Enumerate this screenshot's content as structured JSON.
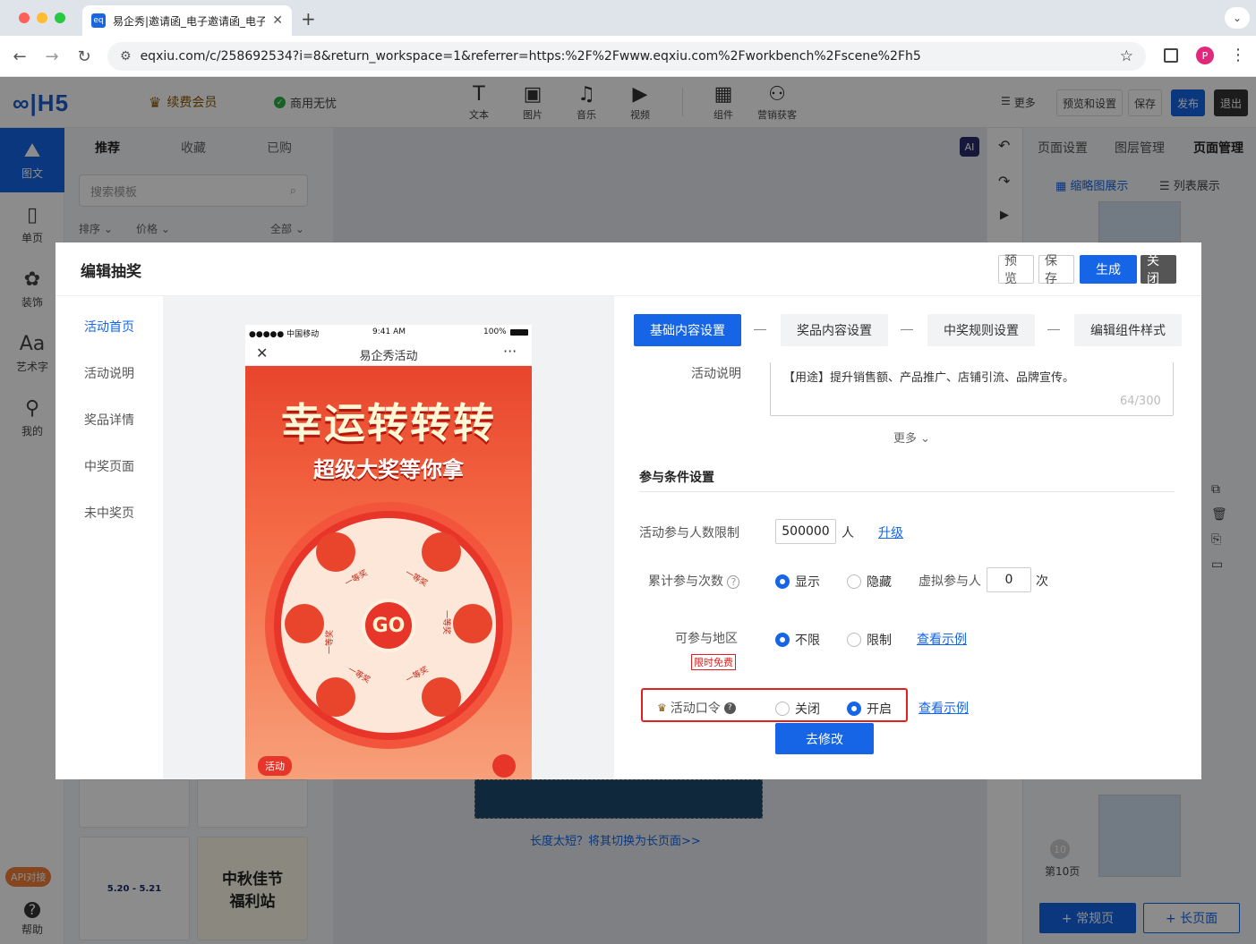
{
  "browser": {
    "tab_title": "易企秀|邀请函_电子邀请函_电子",
    "tab_favicon": "eq",
    "url": "eqxiu.com/c/258692534?i=8&return_workspace=1&referrer=https:%2F%2Fwww.eqxiu.com%2Fworkbench%2Fscene%2Fh5",
    "profile_initial": "P"
  },
  "app_header": {
    "logo": "∞|H5",
    "vip_label": "续费会员",
    "commercial_label": "商用无忧",
    "tools": [
      "文本",
      "图片",
      "音乐",
      "视频",
      "组件",
      "营销获客"
    ],
    "more": "更多",
    "preview_settings": "预览和设置",
    "save": "保存",
    "publish": "发布",
    "exit": "退出"
  },
  "rail": {
    "items": [
      "图文",
      "单页",
      "装饰",
      "艺术字",
      "我的"
    ],
    "api_label": "API对接",
    "help_label": "帮助"
  },
  "template_panel": {
    "tabs": [
      "推荐",
      "收藏",
      "已购"
    ],
    "search_placeholder": "搜索模板",
    "filters": [
      "排序",
      "价格",
      "全部"
    ],
    "thumb_text_1": "中秋佳节",
    "thumb_text_2": "福利站",
    "thumb_date": "5.20 - 5.21"
  },
  "canvas": {
    "hint": "长度太短？将其切换为长页面>>",
    "ai_label": "AI"
  },
  "right_panel": {
    "tabs": [
      "页面设置",
      "图层管理",
      "页面管理"
    ],
    "view_thumb": "缩略图展示",
    "view_list": "列表展示",
    "page_badge": "10",
    "page_label": "第10页",
    "add_normal": "+ 常规页",
    "add_long": "+ 长页面"
  },
  "modal": {
    "title": "编辑抽奖",
    "btn_preview": "预览",
    "btn_save": "保存",
    "btn_generate": "生成",
    "btn_close": "关闭",
    "side_items": [
      "活动首页",
      "活动说明",
      "奖品详情",
      "中奖页面",
      "未中奖页"
    ],
    "phone": {
      "carrier": "●●●●● 中国移动",
      "time": "9:41 AM",
      "battery": "100%",
      "page_title": "易企秀活动",
      "banner_title": "幸运转转转",
      "banner_sub": "超级大奖等你拿",
      "go": "GO",
      "prize_labels": [
        "一等奖",
        "一等奖",
        "一等奖",
        "一等奖",
        "一等奖",
        "一等奖"
      ],
      "bottom_badge": "活动"
    },
    "steps": [
      "基础内容设置",
      "奖品内容设置",
      "中奖规则设置",
      "编辑组件样式"
    ],
    "desc_label": "活动说明",
    "desc_text": "【用途】提升销售额、产品推广、店铺引流、品牌宣传。",
    "desc_count": "64/300",
    "more": "更多",
    "section_title": "参与条件设置",
    "limit_label": "活动参与人数限制",
    "limit_value": "500000",
    "limit_unit": "人",
    "upgrade": "升级",
    "count_label": "累计参与次数",
    "show": "显示",
    "hide": "隐藏",
    "virtual_label": "虚拟参与人",
    "virtual_value": "0",
    "virtual_unit": "次",
    "region_label": "可参与地区",
    "free_badge": "限时免费",
    "unlimited": "不限",
    "limited": "限制",
    "view_example": "查看示例",
    "password_label": "活动口令",
    "off": "关闭",
    "on": "开启",
    "view_example_2": "查看示例",
    "go_modify": "去修改",
    "highlight_color": "#e02020",
    "accent_color": "#1565e6"
  }
}
